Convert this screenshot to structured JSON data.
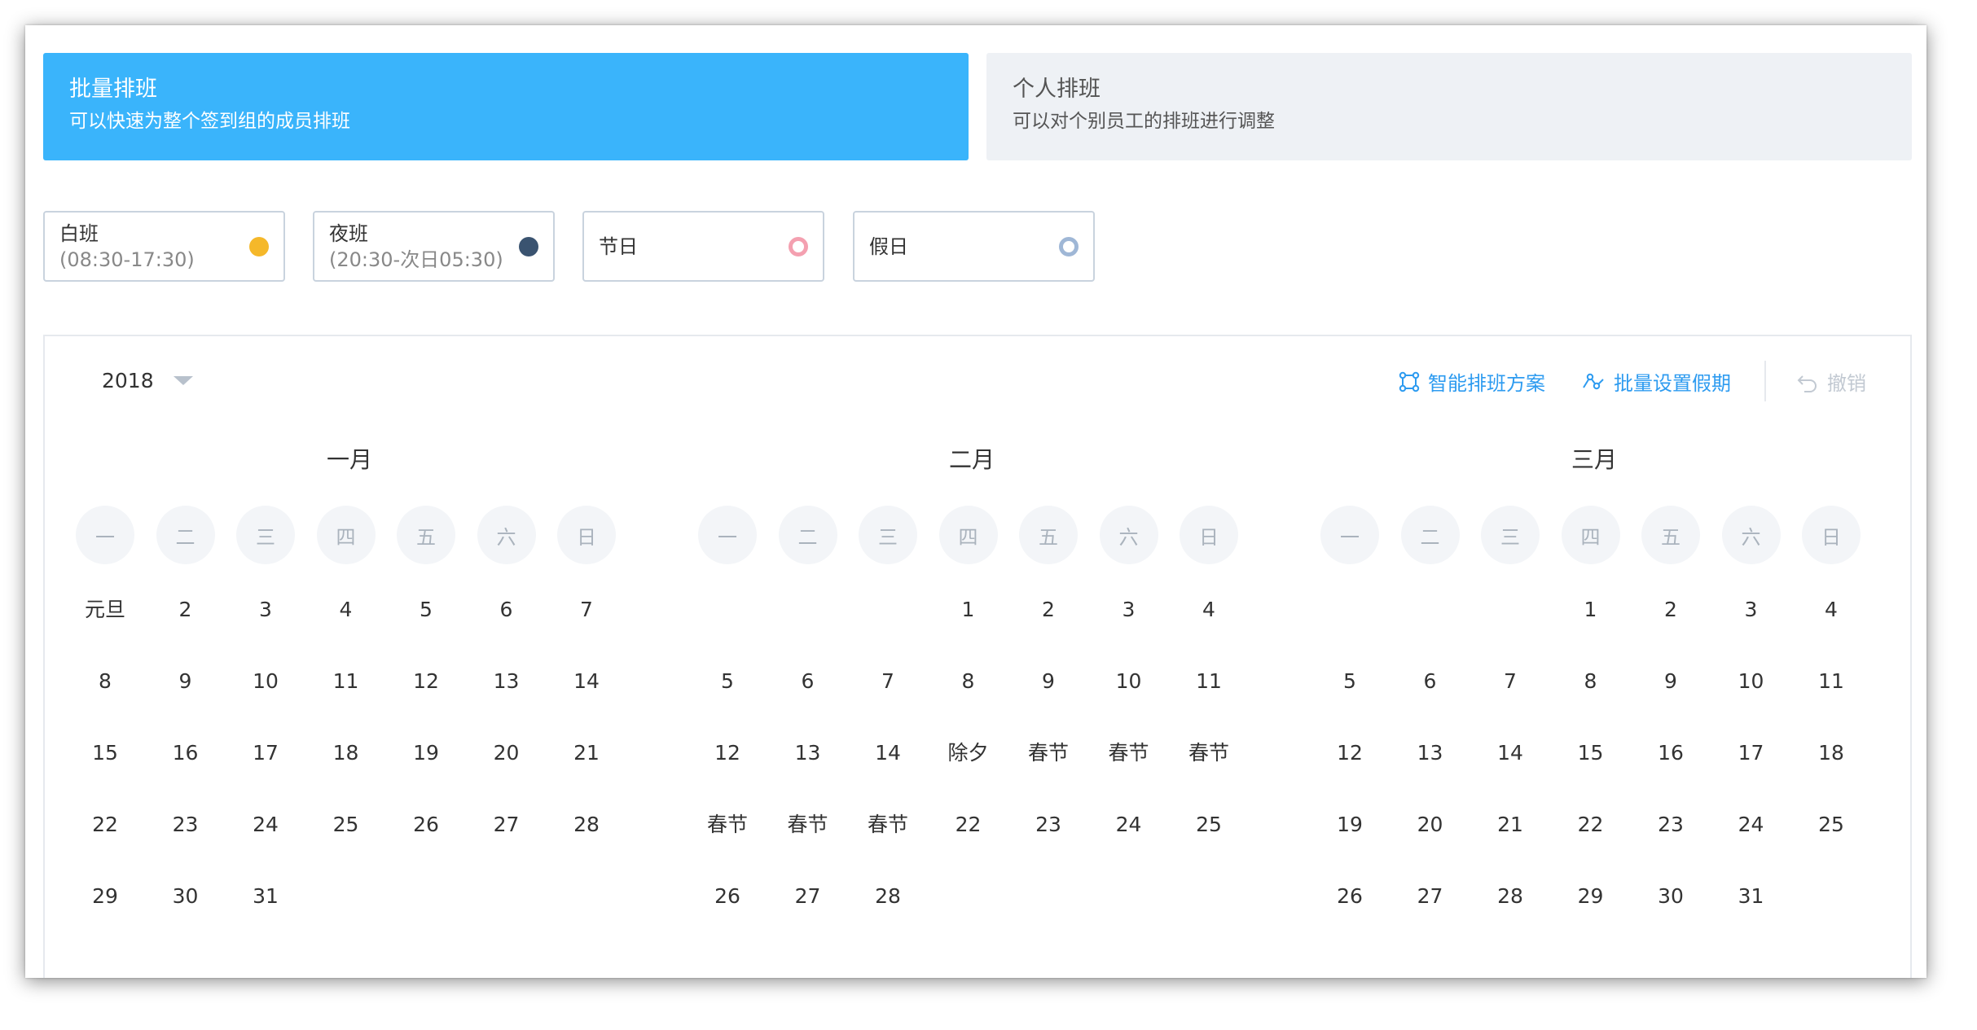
{
  "mode_tabs": [
    {
      "title": "批量排班",
      "desc": "可以快速为整个签到组的成员排班"
    },
    {
      "title": "个人排班",
      "desc": "可以对个别员工的排班进行调整"
    }
  ],
  "shift_types": [
    {
      "name": "白班",
      "time": "(08:30-17:30)",
      "color": "#f5b82a",
      "style": "filled"
    },
    {
      "name": "夜班",
      "time": "(20:30-次日05:30)",
      "color": "#3a5370",
      "style": "filled"
    },
    {
      "name": "节日",
      "time": "",
      "color": "#f4a0b0",
      "style": "ring"
    },
    {
      "name": "假日",
      "time": "",
      "color": "#9fb7d6",
      "style": "ring"
    }
  ],
  "year": "2018",
  "toolbar": {
    "smart_schedule": "智能排班方案",
    "batch_holiday": "批量设置假期",
    "undo": "撤销"
  },
  "weekdays": [
    "一",
    "二",
    "三",
    "四",
    "五",
    "六",
    "日"
  ],
  "months": [
    {
      "name": "一月",
      "rows": [
        [
          "元旦",
          "2",
          "3",
          "4",
          "5",
          "6",
          "7"
        ],
        [
          "8",
          "9",
          "10",
          "11",
          "12",
          "13",
          "14"
        ],
        [
          "15",
          "16",
          "17",
          "18",
          "19",
          "20",
          "21"
        ],
        [
          "22",
          "23",
          "24",
          "25",
          "26",
          "27",
          "28"
        ],
        [
          "29",
          "30",
          "31",
          "",
          "",
          "",
          ""
        ]
      ]
    },
    {
      "name": "二月",
      "rows": [
        [
          "",
          "",
          "",
          "1",
          "2",
          "3",
          "4"
        ],
        [
          "5",
          "6",
          "7",
          "8",
          "9",
          "10",
          "11"
        ],
        [
          "12",
          "13",
          "14",
          "除夕",
          "春节",
          "春节",
          "春节"
        ],
        [
          "春节",
          "春节",
          "春节",
          "22",
          "23",
          "24",
          "25"
        ],
        [
          "26",
          "27",
          "28",
          "",
          "",
          "",
          ""
        ]
      ]
    },
    {
      "name": "三月",
      "rows": [
        [
          "",
          "",
          "",
          "1",
          "2",
          "3",
          "4"
        ],
        [
          "5",
          "6",
          "7",
          "8",
          "9",
          "10",
          "11"
        ],
        [
          "12",
          "13",
          "14",
          "15",
          "16",
          "17",
          "18"
        ],
        [
          "19",
          "20",
          "21",
          "22",
          "23",
          "24",
          "25"
        ],
        [
          "26",
          "27",
          "28",
          "29",
          "30",
          "31",
          ""
        ]
      ]
    }
  ],
  "colors": {
    "accent": "#3ab4fb",
    "link": "#2d9bf0",
    "disabled": "#c2c9d2"
  }
}
